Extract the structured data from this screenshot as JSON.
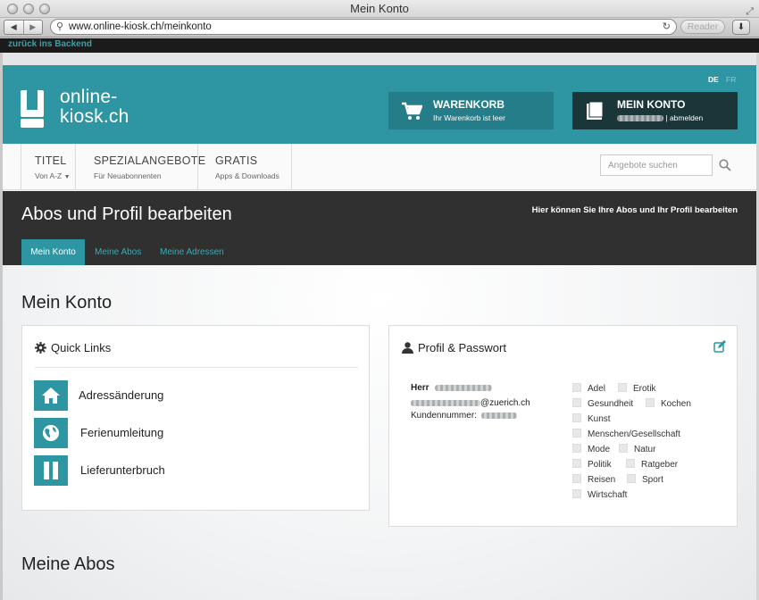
{
  "browser": {
    "window_title": "Mein Konto",
    "url": "www.online-kiosk.ch/meinkonto",
    "reader_label": "Reader"
  },
  "backend": {
    "link_label": "zurück ins Backend"
  },
  "header": {
    "logo_text": "online-\nkiosk.ch",
    "lang_de": "DE",
    "lang_fr": "FR",
    "cart": {
      "title": "WARENKORB",
      "subtitle": "Ihr Warenkorb ist leer"
    },
    "account": {
      "title": "MEIN KONTO",
      "logout": "| abmelden"
    }
  },
  "nav": {
    "items": [
      {
        "label": "TITEL",
        "sub": "Von A-Z"
      },
      {
        "label": "SPEZIALANGEBOTE",
        "sub": "Für Neuabonnenten"
      },
      {
        "label": "GRATIS",
        "sub": "Apps & Downloads"
      }
    ],
    "search_placeholder": "Angebote suchen"
  },
  "band": {
    "title": "Abos und Profil bearbeiten",
    "hint": "Hier können Sie Ihre Abos und Ihr Profil bearbeiten",
    "tabs": [
      "Mein Konto",
      "Meine Abos",
      "Meine Adressen"
    ]
  },
  "content": {
    "section_title": "Mein Konto",
    "quick_links": {
      "title": "Quick Links",
      "items": [
        "Adressänderung",
        "Ferienumleitung",
        "Lieferunterbruch"
      ]
    },
    "profile": {
      "title": "Profil & Passwort",
      "salutation": "Herr",
      "email_suffix": "@zuerich.ch",
      "customer_label": "Kundennummer:",
      "interests": [
        "Adel",
        "Erotik",
        "Gesundheit",
        "Kochen",
        "Kunst",
        "Menschen/Gesellschaft",
        "Mode",
        "Natur",
        "Politik",
        "Ratgeber",
        "Reisen",
        "Sport",
        "Wirtschaft"
      ]
    },
    "abos_title": "Meine Abos"
  },
  "colors": {
    "teal": "#2e96a3",
    "dark": "#303030",
    "account_bg": "#1a3639"
  }
}
